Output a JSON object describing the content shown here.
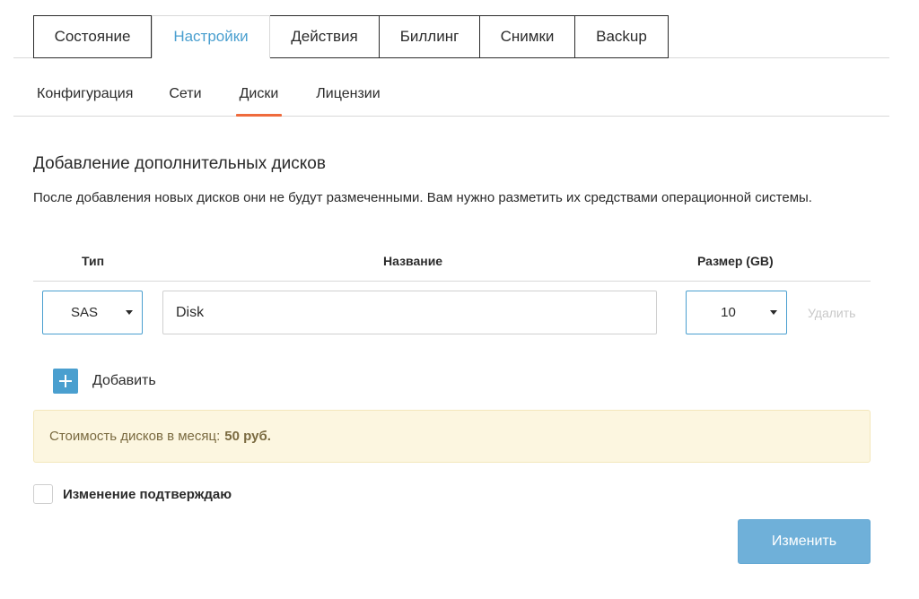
{
  "main_tabs": [
    {
      "label": "Состояние",
      "active": false
    },
    {
      "label": "Настройки",
      "active": true
    },
    {
      "label": "Действия",
      "active": false
    },
    {
      "label": "Биллинг",
      "active": false
    },
    {
      "label": "Снимки",
      "active": false
    },
    {
      "label": "Backup",
      "active": false
    }
  ],
  "sub_tabs": [
    {
      "label": "Конфигурация",
      "active": false
    },
    {
      "label": "Сети",
      "active": false
    },
    {
      "label": "Диски",
      "active": true
    },
    {
      "label": "Лицензии",
      "active": false
    }
  ],
  "section": {
    "title": "Добавление дополнительных дисков",
    "description": "После добавления новых дисков они не будут размеченными. Вам нужно разметить их средствами операционной системы."
  },
  "table": {
    "headers": {
      "type": "Тип",
      "name": "Название",
      "size": "Размер (GB)"
    },
    "row": {
      "type": "SAS",
      "name": "Disk",
      "size": "10",
      "delete": "Удалить"
    }
  },
  "add_label": "Добавить",
  "cost": {
    "label": "Стоимость дисков в месяц:",
    "value": "50 руб."
  },
  "confirm_label": "Изменение подтверждаю",
  "submit_label": "Изменить",
  "colors": {
    "accent": "#4a9fcf",
    "active_underline": "#ef6b3c",
    "notice_bg": "#fcf6e0",
    "button": "#6fb0d9"
  }
}
